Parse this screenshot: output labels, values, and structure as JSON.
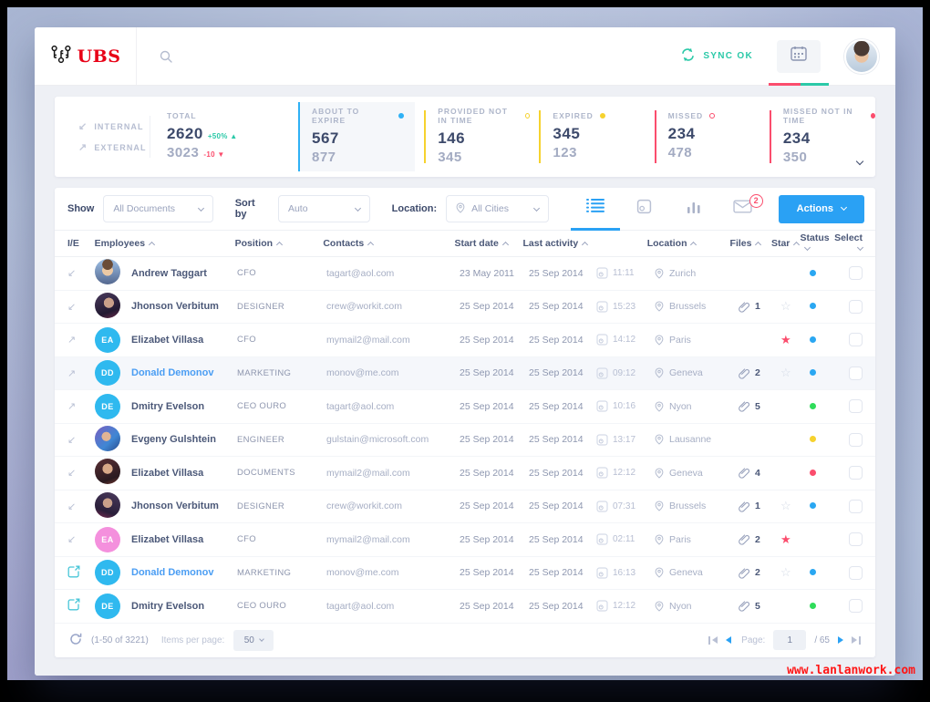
{
  "watermark": "www.lanlanwork.com",
  "topbar": {
    "logo": "UBS",
    "sync_label": "SYNC OK"
  },
  "stats": {
    "internal_label": "INTERNAL",
    "external_label": "EXTERNAL",
    "total_label": "TOTAL",
    "total_internal": "2620",
    "total_internal_delta": "+50%",
    "total_external": "3023",
    "total_external_delta": "-10",
    "cards": [
      {
        "label": "ABOUT TO EXPIRE",
        "value1": "567",
        "value2": "877",
        "color": "#2fb1f5",
        "dot": "filled",
        "highlight": true
      },
      {
        "label": "PROVIDED NOT IN TIME",
        "value1": "146",
        "value2": "345",
        "color": "#f6d22e",
        "dot": "hollow",
        "highlight": false
      },
      {
        "label": "EXPIRED",
        "value1": "345",
        "value2": "123",
        "color": "#f6d22e",
        "dot": "filled",
        "highlight": false
      },
      {
        "label": "MISSED",
        "value1": "234",
        "value2": "478",
        "color": "#fb4d6d",
        "dot": "hollow",
        "highlight": false
      },
      {
        "label": "MISSED NOT IN TIME",
        "value1": "234",
        "value2": "350",
        "color": "#fb4d6d",
        "dot": "filled",
        "highlight": false
      }
    ]
  },
  "filters": {
    "show_label": "Show",
    "show_value": "All Documents",
    "sort_label": "Sort by",
    "sort_value": "Auto",
    "location_label": "Location:",
    "location_value": "All Cities",
    "mail_badge": "2",
    "actions_label": "Actions"
  },
  "table": {
    "columns": [
      "I/E",
      "Employees",
      "Position",
      "Contacts",
      "Start date",
      "Last activity",
      "Location",
      "Files",
      "Star",
      "Status",
      "Select"
    ],
    "status_colors": {
      "blue": "#2aa7f2",
      "green": "#2fdc5a",
      "yellow": "#f6d22e",
      "red": "#fb4d6d"
    },
    "rows": [
      {
        "ie": "internal",
        "avatar": {
          "kind": "photo",
          "photo": "p1"
        },
        "name": "Andrew Taggart",
        "link": false,
        "position": "CFO",
        "contact": "tagart@aol.com",
        "start_date": "23 May 2011",
        "last_date": "25 Sep 2014",
        "last_time": "11:11",
        "location": "Zurich",
        "files": null,
        "star": "none",
        "status": "blue",
        "highlight": false
      },
      {
        "ie": "internal",
        "avatar": {
          "kind": "photo",
          "photo": "p2"
        },
        "name": "Jhonson Verbitum",
        "link": false,
        "position": "DESIGNER",
        "contact": "crew@workit.com",
        "start_date": "25 Sep 2014",
        "last_date": "25 Sep 2014",
        "last_time": "15:23",
        "location": "Brussels",
        "files": "1",
        "star": "outline",
        "status": "blue",
        "highlight": false
      },
      {
        "ie": "external",
        "avatar": {
          "kind": "initials",
          "text": "EA",
          "bg": "#2fb9ef"
        },
        "name": "Elizabet Villasa",
        "link": false,
        "position": "CFO",
        "contact": "mymail2@mail.com",
        "start_date": "25 Sep 2014",
        "last_date": "25 Sep 2014",
        "last_time": "14:12",
        "location": "Paris",
        "files": null,
        "star": "filled",
        "status": "blue",
        "highlight": false
      },
      {
        "ie": "external",
        "avatar": {
          "kind": "initials",
          "text": "DD",
          "bg": "#2fb9ef"
        },
        "name": "Donald Demonov",
        "link": true,
        "position": "MARKETING",
        "contact": "monov@me.com",
        "start_date": "25 Sep 2014",
        "last_date": "25 Sep 2014",
        "last_time": "09:12",
        "location": "Geneva",
        "files": "2",
        "star": "outline",
        "status": "blue",
        "highlight": true
      },
      {
        "ie": "external",
        "avatar": {
          "kind": "initials",
          "text": "DE",
          "bg": "#2fb9ef"
        },
        "name": "Dmitry Evelson",
        "link": false,
        "position": "CEO OURO",
        "contact": "tagart@aol.com",
        "start_date": "25 Sep 2014",
        "last_date": "25 Sep 2014",
        "last_time": "10:16",
        "location": "Nyon",
        "files": "5",
        "star": "none",
        "status": "green",
        "highlight": false
      },
      {
        "ie": "internal",
        "avatar": {
          "kind": "photo",
          "photo": "p3"
        },
        "name": "Evgeny Gulshtein",
        "link": false,
        "position": "ENGINEER",
        "contact": "gulstain@microsoft.com",
        "start_date": "25 Sep 2014",
        "last_date": "25 Sep 2014",
        "last_time": "13:17",
        "location": "Lausanne",
        "files": null,
        "star": "none",
        "status": "yellow",
        "highlight": false
      },
      {
        "ie": "internal",
        "avatar": {
          "kind": "photo",
          "photo": "p4"
        },
        "name": "Elizabet Villasa",
        "link": false,
        "position": "DOCUMENTS",
        "contact": "mymail2@mail.com",
        "start_date": "25 Sep 2014",
        "last_date": "25 Sep 2014",
        "last_time": "12:12",
        "location": "Geneva",
        "files": "4",
        "star": "none",
        "status": "red",
        "highlight": false
      },
      {
        "ie": "internal",
        "avatar": {
          "kind": "photo",
          "photo": "p5"
        },
        "name": "Jhonson Verbitum",
        "link": false,
        "position": "DESIGNER",
        "contact": "crew@workit.com",
        "start_date": "25 Sep 2014",
        "last_date": "25 Sep 2014",
        "last_time": "07:31",
        "location": "Brussels",
        "files": "1",
        "star": "outline",
        "status": "blue",
        "highlight": false
      },
      {
        "ie": "internal",
        "avatar": {
          "kind": "initials",
          "text": "EA",
          "bg": "#f490dd"
        },
        "name": "Elizabet Villasa",
        "link": false,
        "position": "CFO",
        "contact": "mymail2@mail.com",
        "start_date": "25 Sep 2014",
        "last_date": "25 Sep 2014",
        "last_time": "02:11",
        "location": "Paris",
        "files": "2",
        "star": "filled",
        "status": "none",
        "highlight": false
      },
      {
        "ie": "external-link",
        "avatar": {
          "kind": "initials",
          "text": "DD",
          "bg": "#2fb9ef"
        },
        "name": "Donald Demonov",
        "link": true,
        "position": "MARKETING",
        "contact": "monov@me.com",
        "start_date": "25 Sep 2014",
        "last_date": "25 Sep 2014",
        "last_time": "16:13",
        "location": "Geneva",
        "files": "2",
        "star": "outline",
        "status": "blue",
        "highlight": false
      },
      {
        "ie": "external-link",
        "avatar": {
          "kind": "initials",
          "text": "DE",
          "bg": "#2fb9ef"
        },
        "name": "Dmitry Evelson",
        "link": false,
        "position": "CEO OURO",
        "contact": "tagart@aol.com",
        "start_date": "25 Sep 2014",
        "last_date": "25 Sep 2014",
        "last_time": "12:12",
        "location": "Nyon",
        "files": "5",
        "star": "none",
        "status": "green",
        "highlight": false
      }
    ]
  },
  "footer": {
    "range": "(1-50 of 3221)",
    "per_page_label": "Items per page:",
    "per_page": "50",
    "page_label": "Page:",
    "page": "1",
    "page_total": "/ 65"
  }
}
